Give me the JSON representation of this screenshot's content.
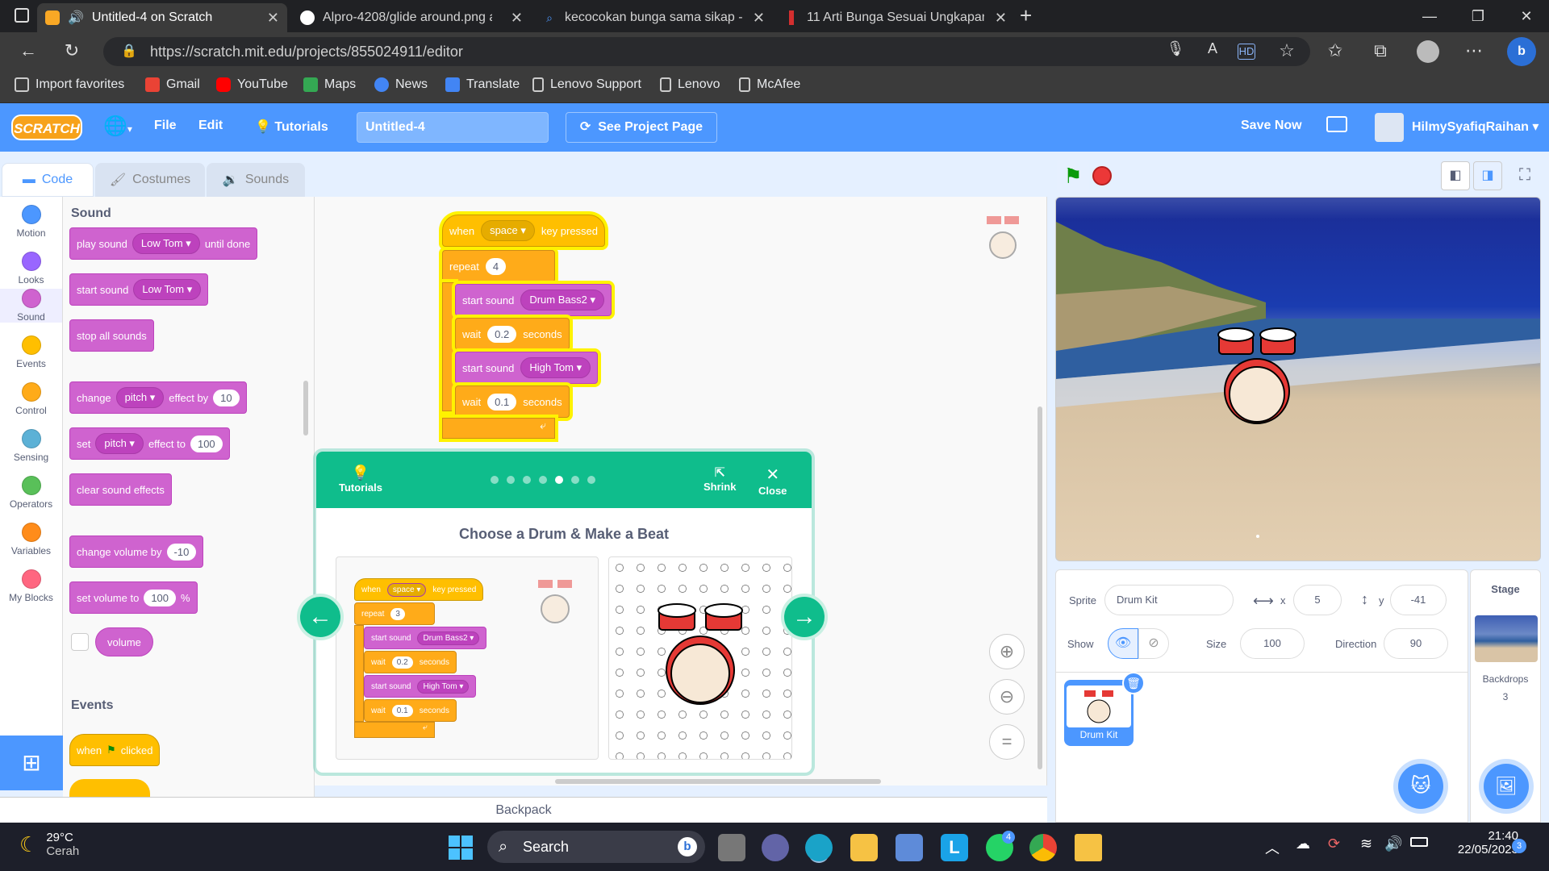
{
  "browser": {
    "tabs": [
      {
        "title": "Untitled-4 on Scratch",
        "active": true
      },
      {
        "title": "Alpro-4208/glide around.png at"
      },
      {
        "title": "kecocokan bunga sama sikap - S"
      },
      {
        "title": "11 Arti Bunga Sesuai Ungkapan"
      }
    ],
    "url": "https://scratch.mit.edu/projects/855024911/editor",
    "favorites": [
      "Import favorites",
      "Gmail",
      "YouTube",
      "Maps",
      "News",
      "Translate",
      "Lenovo Support",
      "Lenovo",
      "McAfee"
    ]
  },
  "menubar": {
    "logo": "SCRATCH",
    "file": "File",
    "edit": "Edit",
    "tutorials": "Tutorials",
    "project_title": "Untitled-4",
    "see_project": "See Project Page",
    "save_now": "Save Now",
    "username": "HilmySyafiqRaihan"
  },
  "editor_tabs": {
    "code": "Code",
    "costumes": "Costumes",
    "sounds": "Sounds"
  },
  "categories": [
    {
      "name": "Motion",
      "color": "#4c97ff"
    },
    {
      "name": "Looks",
      "color": "#9966ff"
    },
    {
      "name": "Sound",
      "color": "#cf63cf"
    },
    {
      "name": "Events",
      "color": "#ffbf00"
    },
    {
      "name": "Control",
      "color": "#ffab19"
    },
    {
      "name": "Sensing",
      "color": "#5cb1d6"
    },
    {
      "name": "Operators",
      "color": "#59c059"
    },
    {
      "name": "Variables",
      "color": "#ff8c1a"
    },
    {
      "name": "My Blocks",
      "color": "#ff6680"
    }
  ],
  "palette": {
    "sound_heading": "Sound",
    "play_sound": {
      "pre": "play sound",
      "dd": "Low Tom",
      "post": "until done"
    },
    "start_sound": {
      "pre": "start sound",
      "dd": "Low Tom"
    },
    "stop_all": "stop all sounds",
    "change_effect": {
      "pre": "change",
      "dd": "pitch",
      "mid": "effect by",
      "val": "10"
    },
    "set_effect": {
      "pre": "set",
      "dd": "pitch",
      "mid": "effect to",
      "val": "100"
    },
    "clear_effects": "clear sound effects",
    "change_volume": {
      "pre": "change volume by",
      "val": "-10"
    },
    "set_volume": {
      "pre": "set volume to",
      "val": "100",
      "post": "%"
    },
    "volume": "volume",
    "events_heading": "Events",
    "when_flag": {
      "pre": "when",
      "post": "clicked"
    }
  },
  "script": {
    "when_key": {
      "pre": "when",
      "dd": "space",
      "post": "key pressed"
    },
    "repeat": {
      "label": "repeat",
      "val": "4"
    },
    "start1": {
      "label": "start sound",
      "dd": "Drum Bass2"
    },
    "wait1": {
      "pre": "wait",
      "val": "0.2",
      "post": "seconds"
    },
    "start2": {
      "label": "start sound",
      "dd": "High Tom"
    },
    "wait2": {
      "pre": "wait",
      "val": "0.1",
      "post": "seconds"
    }
  },
  "tutorial": {
    "label": "Tutorials",
    "shrink": "Shrink",
    "close": "Close",
    "title": "Choose a Drum & Make a Beat",
    "step_count": 7,
    "current_step": 5,
    "example": {
      "when_key": {
        "pre": "when",
        "dd": "space",
        "post": "key pressed"
      },
      "repeat": {
        "label": "repeat",
        "val": "3"
      },
      "start1": {
        "label": "start sound",
        "dd": "Drum Bass2"
      },
      "wait1": {
        "pre": "wait",
        "val": "0.2",
        "post": "seconds"
      },
      "start2": {
        "label": "start sound",
        "dd": "High Tom"
      },
      "wait2": {
        "pre": "wait",
        "val": "0.1",
        "post": "seconds"
      }
    }
  },
  "backpack": "Backpack",
  "sprite_info": {
    "sprite_label": "Sprite",
    "sprite_name": "Drum Kit",
    "x_label": "x",
    "x": "5",
    "y_label": "y",
    "y": "-41",
    "show_label": "Show",
    "size_label": "Size",
    "size": "100",
    "direction_label": "Direction",
    "direction": "90",
    "thumb_name": "Drum Kit"
  },
  "stage_pane": {
    "title": "Stage",
    "backdrops_label": "Backdrops",
    "backdrops_count": "3"
  },
  "taskbar": {
    "temp": "29°C",
    "weather": "Cerah",
    "search": "Search",
    "time": "21:40",
    "date": "22/05/2023",
    "whatsapp_badge": "4",
    "notif_badge": "3"
  }
}
